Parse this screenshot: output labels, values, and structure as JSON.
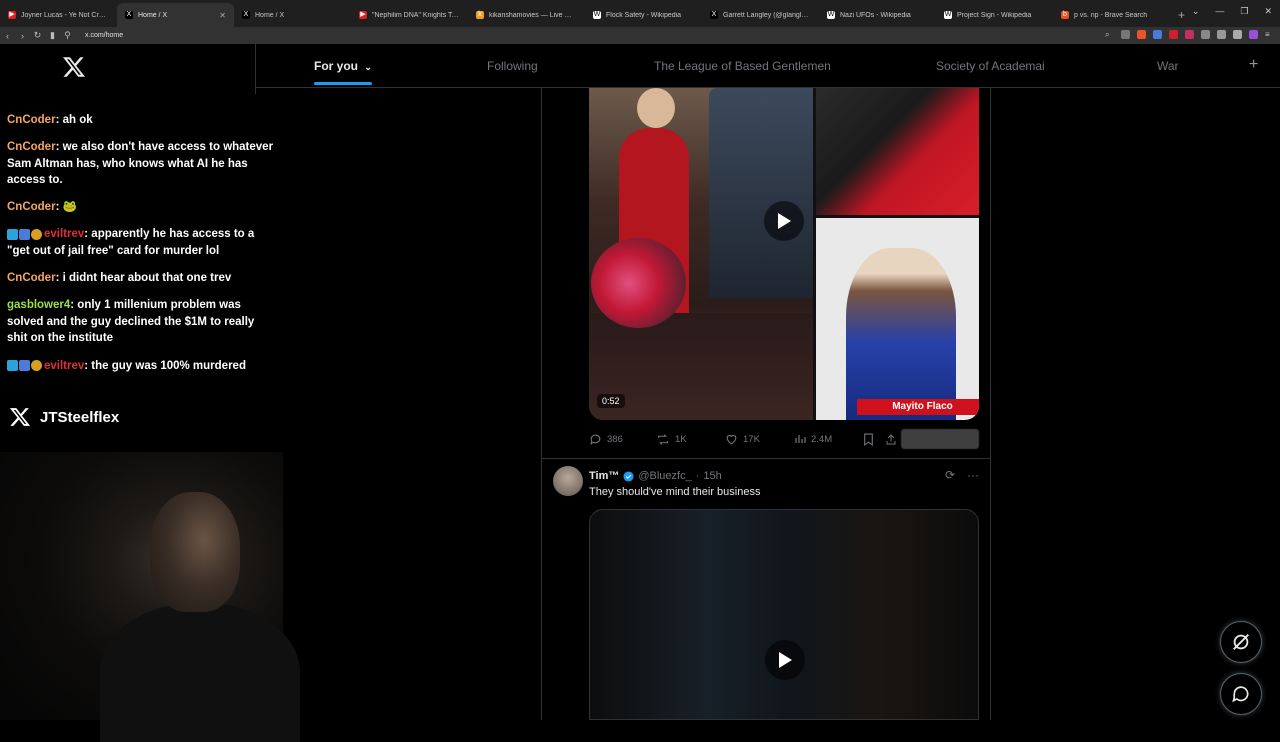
{
  "browser": {
    "tabs": [
      {
        "label": "Joyner Lucas - Ye Not Crazy (Offi",
        "fav_color": "#e02020",
        "fav": "▶"
      },
      {
        "label": "Home / X",
        "fav_color": "#000000",
        "fav": "X",
        "active": true
      },
      {
        "label": "Home / X",
        "fav_color": "#000000",
        "fav": "X"
      },
      {
        "label": "\"Nephilim DNA\" Knights Templar",
        "fav_color": "#e02020",
        "fav": "▶"
      },
      {
        "label": "kikanshamovies — Live Movie Ch",
        "fav_color": "#f0a020",
        "fav": "k"
      },
      {
        "label": "Flock Safety - Wikipedia",
        "fav_color": "#ffffff",
        "fav": "W"
      },
      {
        "label": "Garrett Langley (@glangley) / X",
        "fav_color": "#000000",
        "fav": "X"
      },
      {
        "label": "Nazi UFOs - Wikipedia",
        "fav_color": "#ffffff",
        "fav": "W"
      },
      {
        "label": "Project Sign - Wikipedia",
        "fav_color": "#ffffff",
        "fav": "W"
      },
      {
        "label": "p vs. np - Brave Search",
        "fav_color": "#f05020",
        "fav": "b"
      }
    ],
    "url": "x.com/home"
  },
  "topnav": {
    "tabs": [
      "For you",
      "Following",
      "The League of Based Gentlemen",
      "Society of Academai",
      "War"
    ]
  },
  "chat": {
    "messages": [
      {
        "user": "CnCoder",
        "user_color": "#f6a563",
        "text": ": ah ok",
        "badges": false
      },
      {
        "user": "CnCoder",
        "user_color": "#f6a563",
        "text": ": we also don't have access to whatever Sam Altman has, who knows what AI he has access to.",
        "badges": false
      },
      {
        "user": "CnCoder",
        "user_color": "#f6a563",
        "text": ": 🐸",
        "badges": false
      },
      {
        "user": "eviltrev",
        "user_color": "#e0303a",
        "text": ": apparently he has access to a \"get out of jail free\" card for murder lol",
        "badges": true
      },
      {
        "user": "CnCoder",
        "user_color": "#f6a563",
        "text": ": i didnt hear about that one trev",
        "badges": false
      },
      {
        "user": "gasblower4",
        "user_color": "#9be04a",
        "text": ": only 1 millenium problem was solved and the guy declined the $1M to really shit on the institute",
        "badges": false
      },
      {
        "user": "eviltrev",
        "user_color": "#e0303a",
        "text": ": the guy was 100% murdered",
        "badges": true
      }
    ],
    "streamer_handle": "JTSteelflex"
  },
  "post1": {
    "duration": "0:52",
    "caption": "Mayito Flaco",
    "replies": "386",
    "reposts": "1K",
    "likes": "17K",
    "views": "2.4M"
  },
  "post2": {
    "name": "Tim™",
    "handle": "@Bluezfc_",
    "time": "15h",
    "text": "They should've mind their business"
  },
  "colors": {
    "accent": "#1d9bf0",
    "verified": "#1d9bf0"
  }
}
